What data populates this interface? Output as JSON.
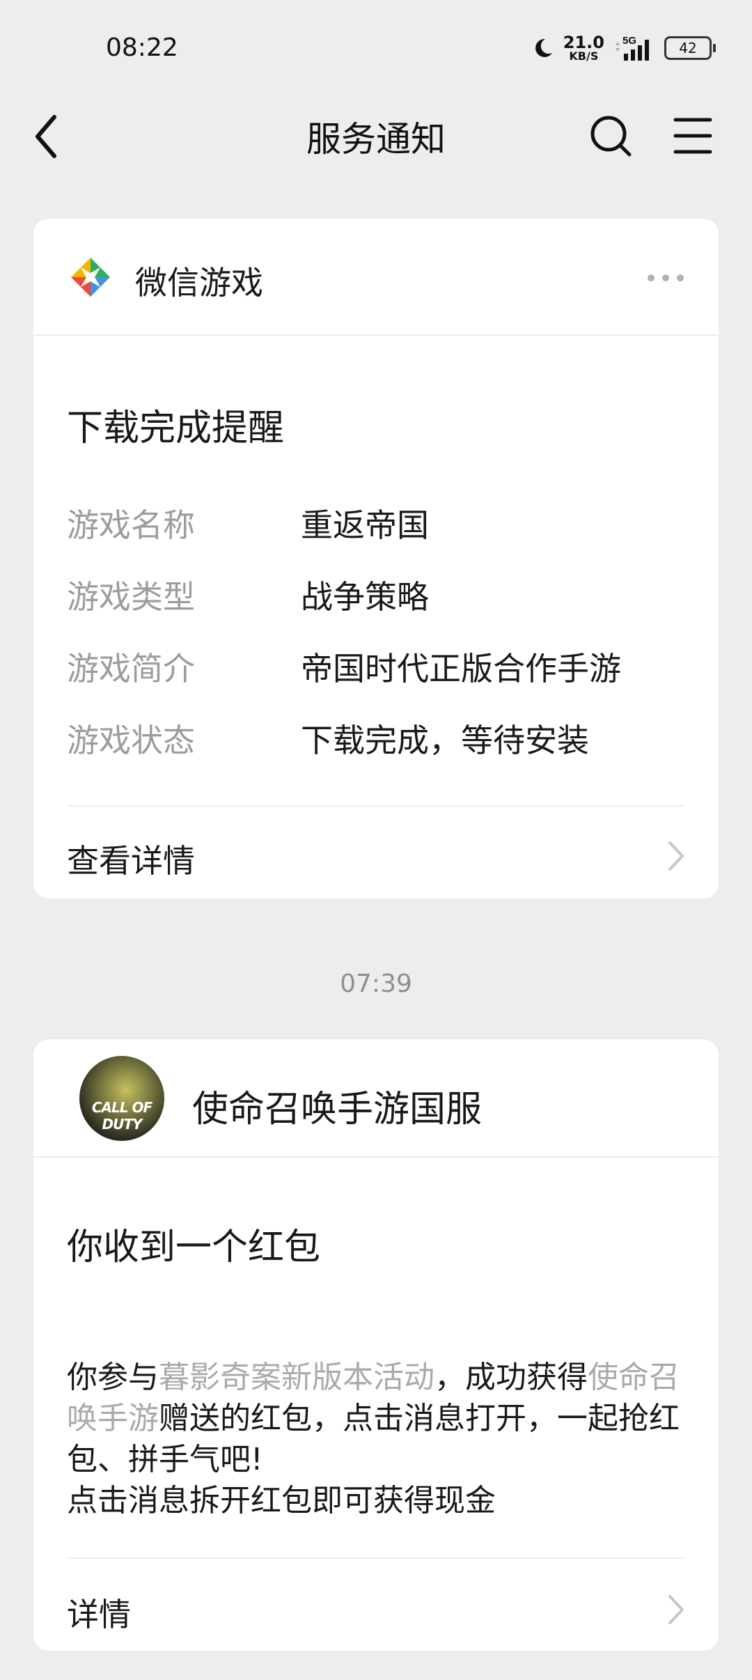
{
  "status_bar": {
    "time": "08:22",
    "net_speed_value": "21.0",
    "net_speed_unit": "KB/S",
    "network": "5G",
    "battery": "42"
  },
  "nav": {
    "title": "服务通知",
    "back_icon": "back-chevron-icon",
    "search_icon": "search-icon",
    "menu_icon": "menu-icon"
  },
  "notifications": [
    {
      "app_name": "微信游戏",
      "app_icon": "wechat-game-icon",
      "title": "下载完成提醒",
      "fields": [
        {
          "label": "游戏名称",
          "value": "重返帝国"
        },
        {
          "label": "游戏类型",
          "value": "战争策略"
        },
        {
          "label": "游戏简介",
          "value": "帝国时代正版合作手游"
        },
        {
          "label": "游戏状态",
          "value": "下载完成，等待安装"
        }
      ],
      "link": "查看详情"
    },
    {
      "timestamp": "07:39",
      "app_name": "使命召唤手游国服",
      "avatar_text": "CALL OF DUTY",
      "title": "你收到一个红包",
      "body": {
        "p1": "你参与",
        "h1": "暮影奇案新版本活动",
        "p2": "，成功获得",
        "h2": "使命召唤手游",
        "p3": "赠送的红包，点击消息打开，一起抢红包、拼手气吧!",
        "line2": "点击消息拆开红包即可获得现金"
      },
      "link": "详情"
    }
  ],
  "colors": {
    "background": "#ededed",
    "card": "#ffffff",
    "label_gray": "#9c9c9c",
    "highlight_gray": "#aaaaaa",
    "text": "#191919"
  }
}
